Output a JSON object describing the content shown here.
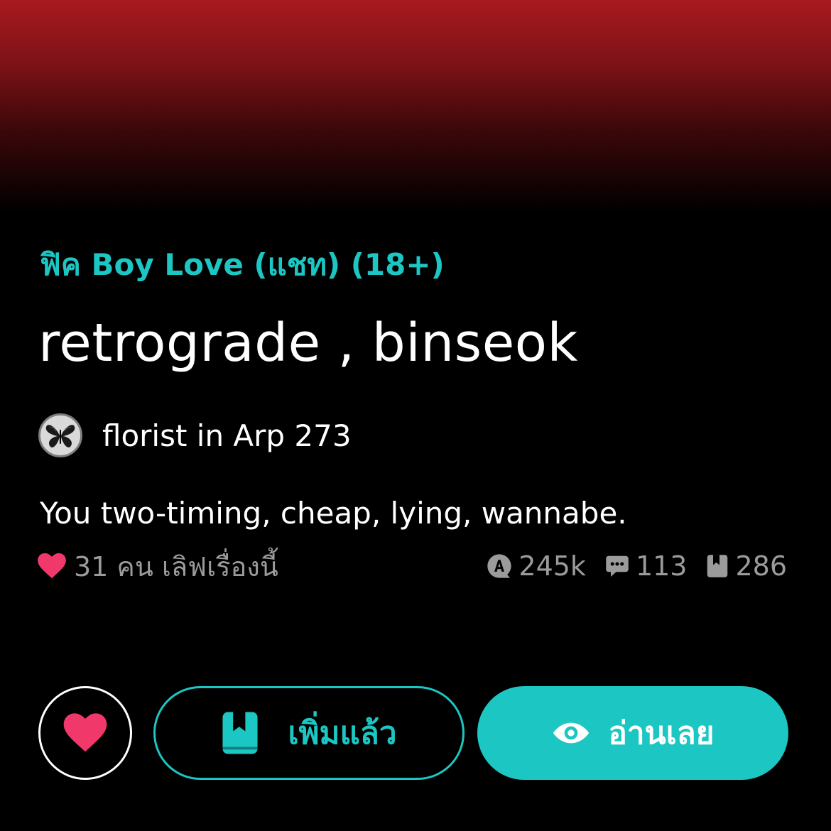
{
  "story": {
    "category": "ฟิค Boy Love (แชท) (18+)",
    "title": "retrograde , binseok",
    "author": "florist in Arp 273",
    "description": "You two-timing, cheap, lying, wannabe.",
    "likes_text": "31 คน เลิฟเรื่องนี้",
    "stats": {
      "views": "245k",
      "comments": "113",
      "chapters": "286"
    }
  },
  "actions": {
    "added_label": "เพิ่มแล้ว",
    "read_label": "อ่านเลย"
  },
  "icons": {
    "avatar": "butterfly-avatar",
    "likes": "heart-icon",
    "views": "view-count-icon",
    "comments": "comment-icon",
    "chapters": "chapter-icon",
    "like_button": "heart-icon",
    "added_button": "bookmark-icon",
    "read_button": "eye-icon"
  },
  "colors": {
    "accent": "#1cc6c2",
    "heart": "#f0386b",
    "muted_text": "#9b9b9b",
    "hero_red": "#a81a1e"
  }
}
